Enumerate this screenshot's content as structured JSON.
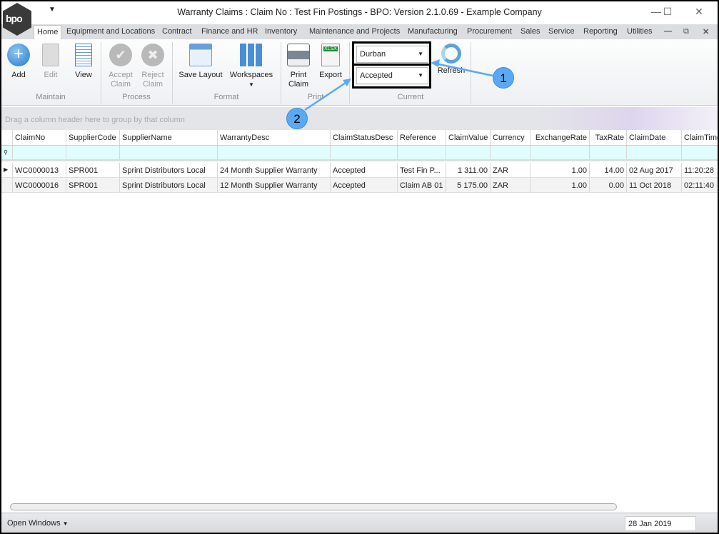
{
  "window": {
    "title": "Warranty Claims : Claim No : Test Fin Postings - BPO: Version 2.1.0.69 - Example Company",
    "logo_text": "bpo",
    "controls": [
      "minimize",
      "maximize",
      "close"
    ]
  },
  "menu_tabs": [
    "Home",
    "Equipment and Locations",
    "Contract",
    "Finance and HR",
    "Inventory",
    "Maintenance and Projects",
    "Manufacturing",
    "Procurement",
    "Sales",
    "Service",
    "Reporting",
    "Utilities"
  ],
  "ribbon": {
    "maintain": {
      "label": "Maintain",
      "add": "Add",
      "edit": "Edit",
      "view": "View"
    },
    "process": {
      "label": "Process",
      "accept": "Accept Claim",
      "reject": "Reject Claim"
    },
    "format": {
      "label": "Format",
      "save_layout": "Save Layout",
      "workspaces": "Workspaces"
    },
    "print": {
      "label": "Print",
      "print_claim": "Print Claim",
      "export": "Export",
      "export_badge": "XLSX"
    },
    "current": {
      "label": "Current",
      "site": "Durban",
      "status": "Accepted",
      "refresh": "Refresh"
    }
  },
  "annotations": [
    "1",
    "2"
  ],
  "grid": {
    "group_hint": "Drag a column header here to group by that column",
    "columns": [
      "ClaimNo",
      "SupplierCode",
      "SupplierName",
      "WarrantyDesc",
      "ClaimStatusDesc",
      "Reference",
      "ClaimValue",
      "Currency",
      "ExchangeRate",
      "TaxRate",
      "ClaimDate",
      "ClaimTime"
    ],
    "rows": [
      [
        "WC0000013",
        "SPR001",
        "Sprint Distributors Local",
        "24 Month Supplier Warranty",
        "Accepted",
        "Test Fin P...",
        "1 311.00",
        "ZAR",
        "1.00",
        "14.00",
        "02 Aug 2017",
        "11:20:28"
      ],
      [
        "WC0000016",
        "SPR001",
        "Sprint Distributors Local",
        "12 Month Supplier Warranty",
        "Accepted",
        "Claim AB 01",
        "5 175.00",
        "ZAR",
        "1.00",
        "0.00",
        "11 Oct 2018",
        "02:11:40"
      ]
    ]
  },
  "status_bar": {
    "open_windows": "Open Windows",
    "date": "28 Jan 2019"
  },
  "colors": {
    "accent": "#5aa9f2",
    "filter_row": "#dffefe"
  }
}
